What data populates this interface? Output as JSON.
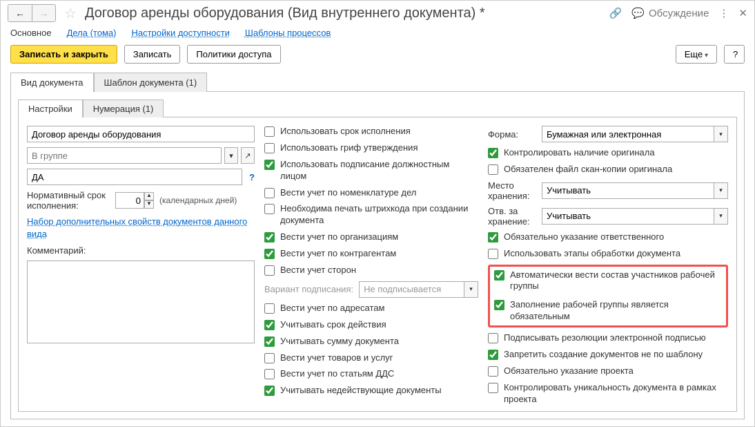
{
  "header": {
    "title": "Договор аренды оборудования (Вид внутреннего документа) *",
    "discussion": "Обсуждение"
  },
  "secnav": {
    "main": "Основное",
    "cases": "Дела (тома)",
    "access": "Настройки доступности",
    "templates": "Шаблоны процессов"
  },
  "toolbar": {
    "save_close": "Записать и закрыть",
    "save": "Записать",
    "policies": "Политики доступа",
    "more": "Еще",
    "help": "?"
  },
  "tabs": {
    "doc_type": "Вид документа",
    "doc_template": "Шаблон документа (1)"
  },
  "inner_tabs": {
    "settings": "Настройки",
    "numbering": "Нумерация (1)"
  },
  "left": {
    "name": "Договор аренды оборудования",
    "group_placeholder": "В группе",
    "index": "ДА",
    "norm_label": "Нормативный срок исполнения:",
    "norm_value": "0",
    "norm_unit": "(календарных дней)",
    "props_link": "Набор дополнительных свойств документов данного вида",
    "comment_label": "Комментарий:"
  },
  "mid": {
    "c1": "Использовать срок исполнения",
    "c2": "Использовать гриф утверждения",
    "c3": "Использовать подписание должностным лицом",
    "c4": "Вести учет по номенклатуре дел",
    "c5": "Необходима печать штрихкода при создании документа",
    "c6": "Вести учет по организациям",
    "c7": "Вести учет по контрагентам",
    "c8": "Вести учет сторон",
    "sign_variant_label": "Вариант подписания:",
    "sign_variant_value": "Не подписывается",
    "c9": "Вести учет по адресатам",
    "c10": "Учитывать срок действия",
    "c11": "Учитывать сумму документа",
    "c12": "Вести учет товаров и услуг",
    "c13": "Вести учет по статьям ДДС",
    "c14": "Учитывать недействующие документы"
  },
  "right": {
    "form_label": "Форма:",
    "form_value": "Бумажная или электронная",
    "r1": "Контролировать наличие оригинала",
    "r2": "Обязателен файл скан-копии оригинала",
    "storage_label": "Место хранения:",
    "storage_value": "Учитывать",
    "resp_label": "Отв. за хранение:",
    "resp_value": "Учитывать",
    "r3": "Обязательно указание ответственного",
    "r4": "Использовать этапы обработки документа",
    "r5": "Автоматически вести состав участников рабочей группы",
    "r6": "Заполнение рабочей группы является обязательным",
    "r7": "Подписывать резолюции электронной подписью",
    "r8": "Запретить создание документов не по шаблону",
    "r9": "Обязательно указание проекта",
    "r10": "Контролировать уникальность документа в рамках проекта"
  }
}
